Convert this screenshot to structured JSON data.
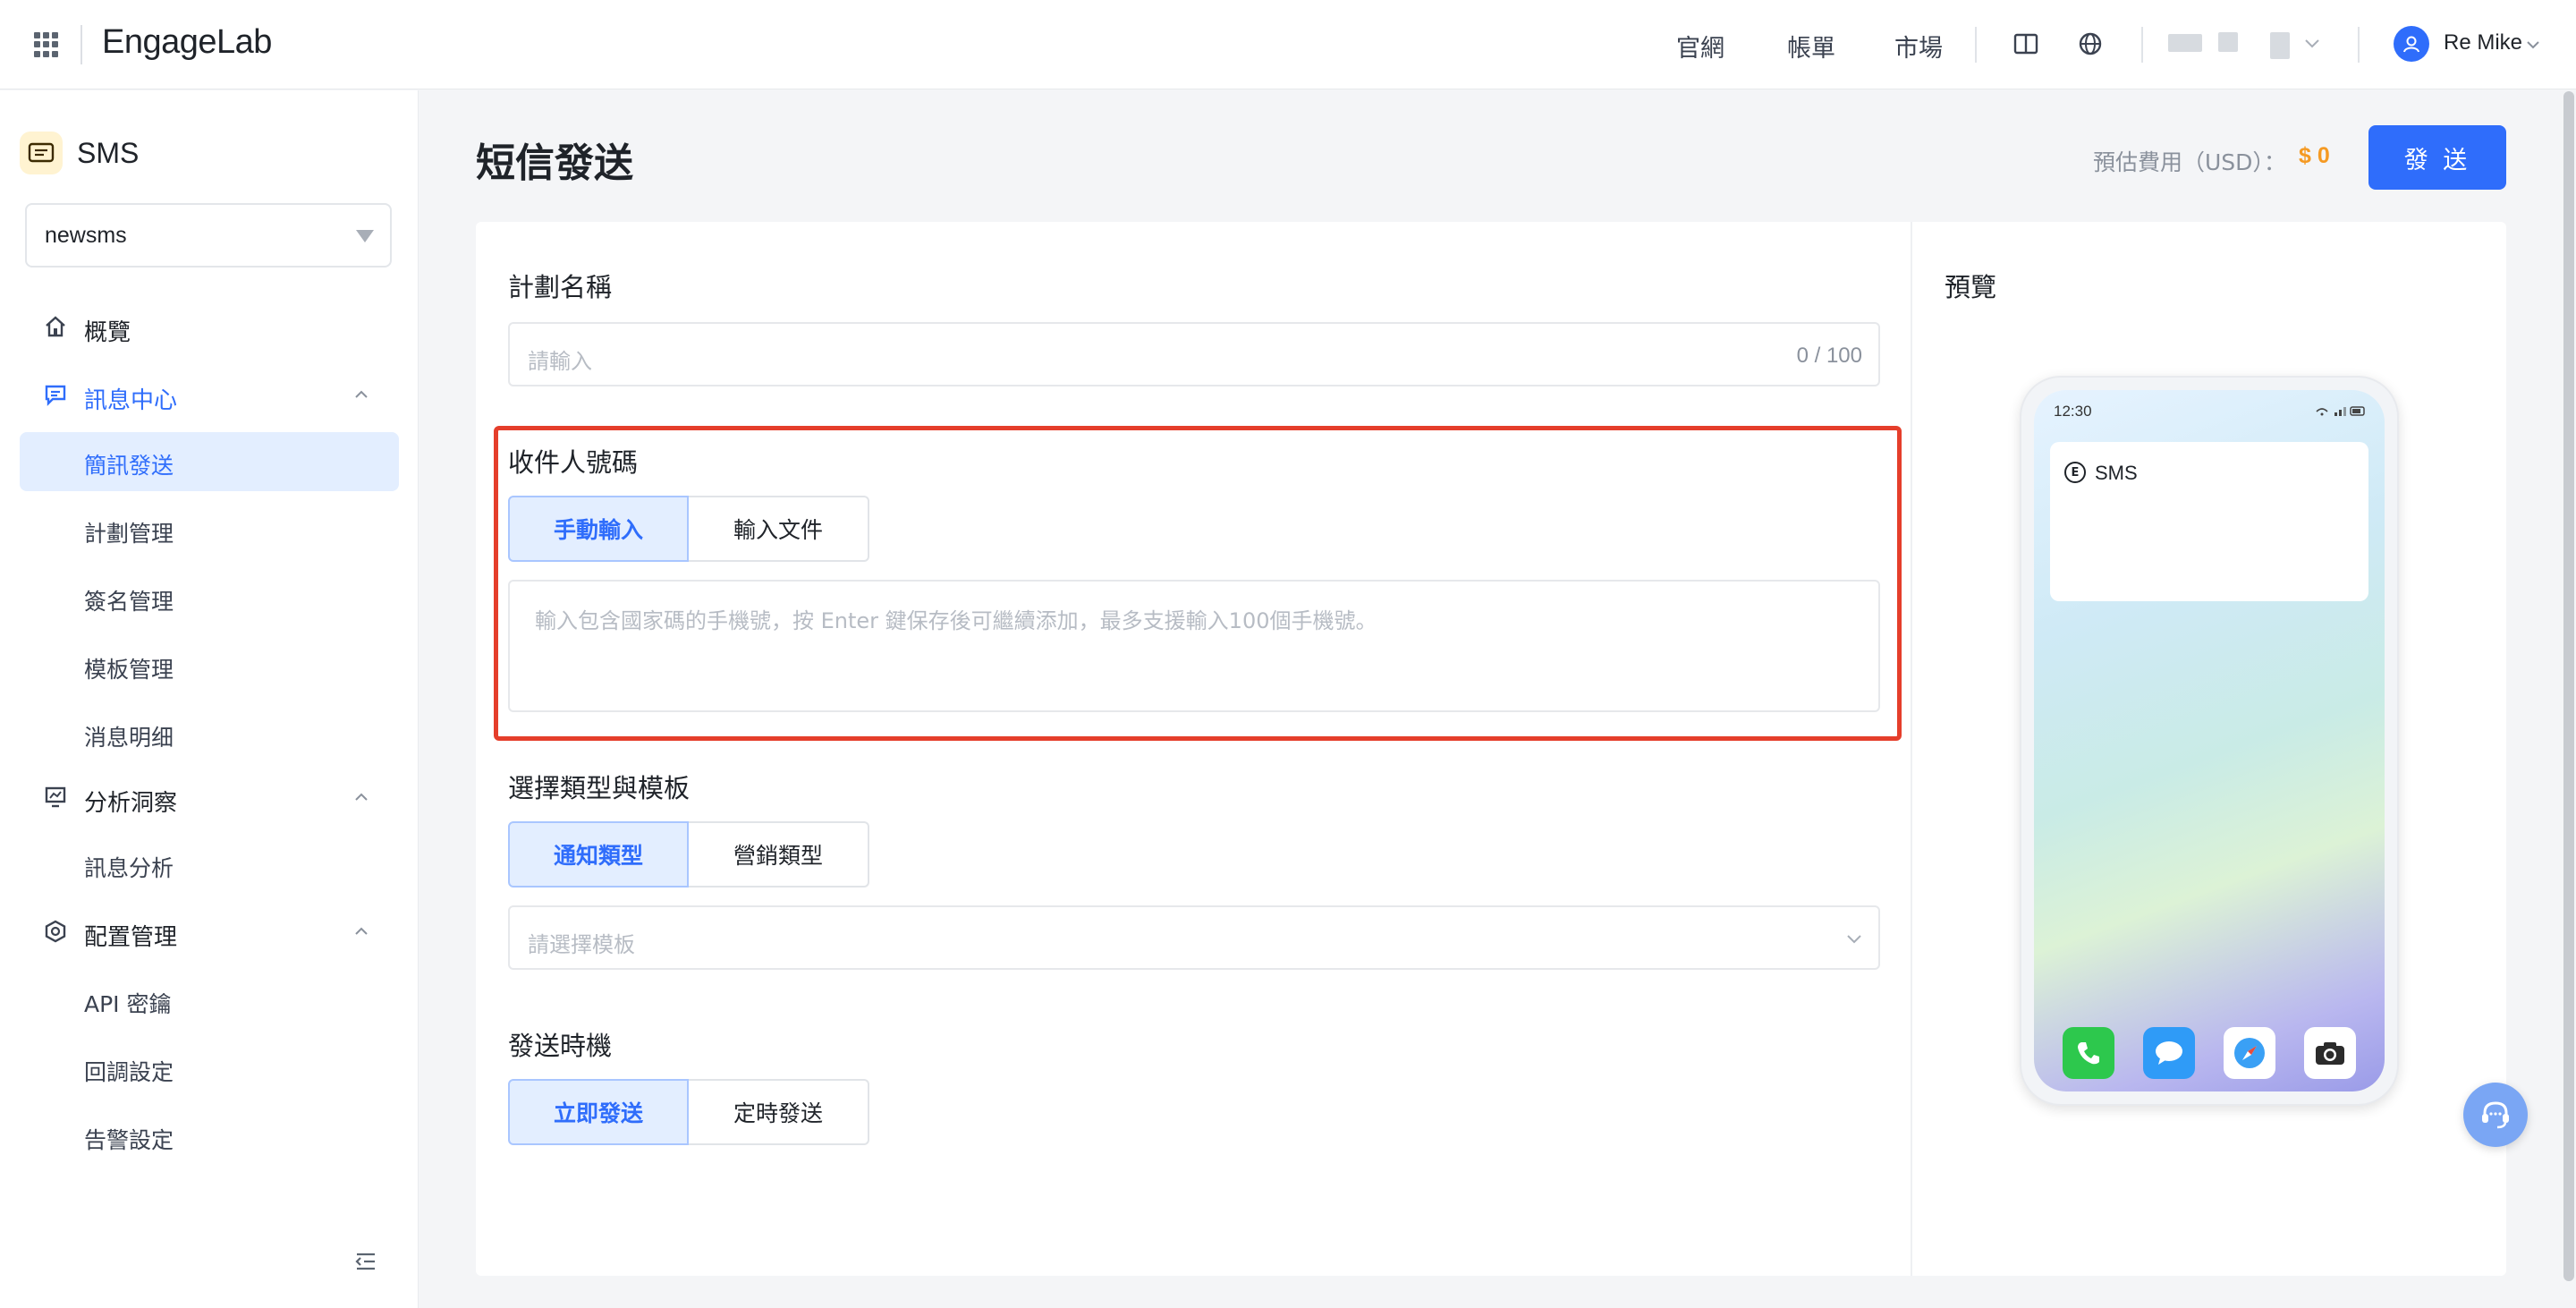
{
  "header": {
    "logo": "EngageLab",
    "nav": [
      "官網",
      "帳單",
      "市場"
    ],
    "user_name": "Re Mike"
  },
  "sidebar": {
    "product": "SMS",
    "app_select_value": "newsms",
    "groups": [
      {
        "label": "概覽"
      },
      {
        "label": "訊息中心",
        "items": [
          "簡訊發送",
          "計劃管理",
          "簽名管理",
          "模板管理",
          "消息明细"
        ]
      },
      {
        "label": "分析洞察",
        "items": [
          "訊息分析"
        ]
      },
      {
        "label": "配置管理",
        "items": [
          "API 密鑰",
          "回調設定",
          "告警設定"
        ]
      }
    ]
  },
  "main": {
    "title": "短信發送",
    "cost_label": "預估費用（USD）：",
    "cost_value": "$ 0",
    "send_button": "發 送",
    "plan_name": {
      "label": "計劃名稱",
      "placeholder": "請輸入",
      "counter": "0 / 100"
    },
    "recipients": {
      "label": "收件人號碼",
      "tabs": [
        "手動輸入",
        "輸入文件"
      ],
      "active_tab": 0,
      "placeholder": "輸入包含國家碼的手機號，按 Enter 鍵保存後可繼續添加，最多支援輸入100個手機號。"
    },
    "template": {
      "label": "選擇類型與模板",
      "tabs": [
        "通知類型",
        "營銷類型"
      ],
      "active_tab": 0,
      "placeholder": "請選擇模板"
    },
    "timing": {
      "label": "發送時機",
      "tabs": [
        "立即發送",
        "定時發送"
      ],
      "active_tab": 0
    }
  },
  "preview": {
    "label": "預覽",
    "phone_time": "12:30",
    "app_name": "SMS",
    "app_icon_letter": "E"
  },
  "colors": {
    "accent": "#2f6dfb",
    "highlight": "#e53e2b",
    "cost": "#f59a23"
  }
}
